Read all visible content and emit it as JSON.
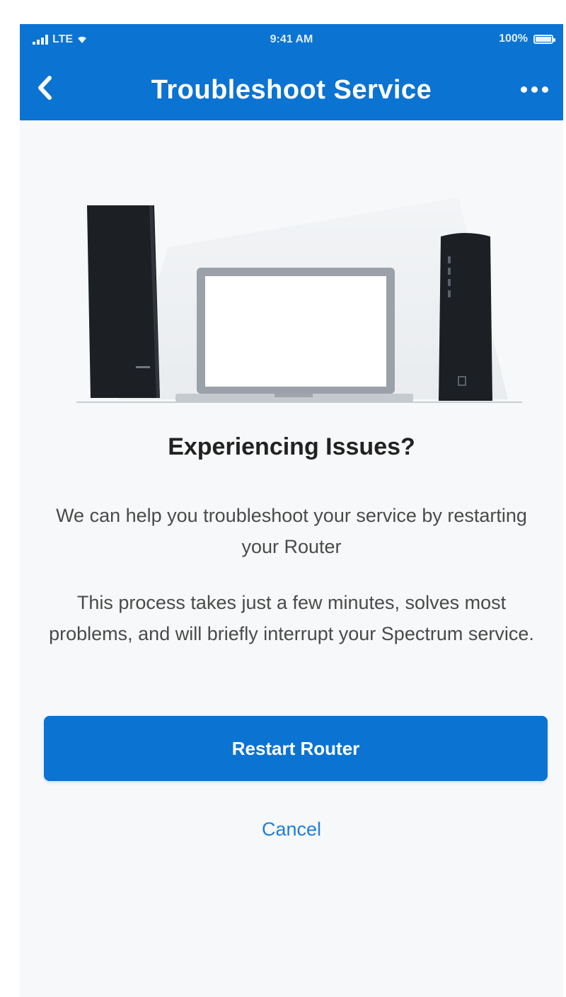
{
  "status_bar": {
    "carrier": "LTE",
    "time": "9:41 AM",
    "battery": "100%"
  },
  "nav": {
    "title": "Troubleshoot Service"
  },
  "content": {
    "heading": "Experiencing Issues?",
    "paragraph1": "We can help you troubleshoot your service by restarting your Router",
    "paragraph2": "This process takes just a few minutes, solves most problems, and will briefly interrupt your Spectrum service."
  },
  "actions": {
    "primary_label": "Restart Router",
    "secondary_label": "Cancel"
  },
  "colors": {
    "brand_blue": "#0b73d2",
    "link_blue": "#1e80d8",
    "background": "#f7f8f9"
  },
  "icons": {
    "back": "chevron-left-icon",
    "more": "more-horizontal-icon"
  }
}
